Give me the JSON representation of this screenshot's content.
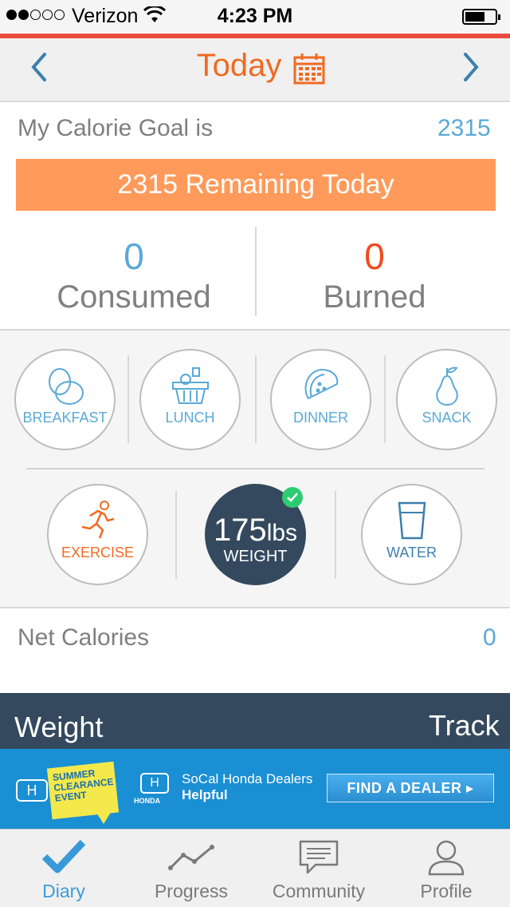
{
  "status_bar": {
    "carrier": "Verizon",
    "time": "4:23 PM",
    "signal_bars": 2,
    "signal_total": 5
  },
  "nav": {
    "title": "Today",
    "prev_icon": "chevron-left-icon",
    "next_icon": "chevron-right-icon",
    "calendar_icon": "calendar-icon"
  },
  "goal": {
    "label": "My Calorie Goal is",
    "value": "2315",
    "remaining_text": "2315 Remaining Today"
  },
  "stats": {
    "consumed_value": "0",
    "consumed_label": "Consumed",
    "burned_value": "0",
    "burned_label": "Burned"
  },
  "meals": [
    {
      "label": "BREAKFAST",
      "icon": "eggs-icon"
    },
    {
      "label": "LUNCH",
      "icon": "basket-icon"
    },
    {
      "label": "DINNER",
      "icon": "taco-icon"
    },
    {
      "label": "SNACK",
      "icon": "pear-icon"
    }
  ],
  "activities": {
    "exercise_label": "EXERCISE",
    "weight_value": "175",
    "weight_unit": "lbs",
    "weight_label": "WEIGHT",
    "water_label": "WATER"
  },
  "net": {
    "label": "Net Calories",
    "value": "0"
  },
  "weight_section": {
    "title": "Weight",
    "action": "Track"
  },
  "ad": {
    "promo_text": "SUMMER CLEARANCE EVENT",
    "brand": "HONDA",
    "dealer_line1": "SoCal Honda Dealers",
    "dealer_line2": "Helpful",
    "cta": "FIND A DEALER ▸"
  },
  "tabs": [
    {
      "label": "Diary",
      "icon": "checkmark-icon",
      "active": true
    },
    {
      "label": "Progress",
      "icon": "chart-line-icon",
      "active": false
    },
    {
      "label": "Community",
      "icon": "chat-bubble-icon",
      "active": false
    },
    {
      "label": "Profile",
      "icon": "person-icon",
      "active": false
    }
  ],
  "colors": {
    "accent_orange": "#f06a22",
    "remaining_bar": "#ff9a5a",
    "blue": "#5aa9d6",
    "burned_red": "#f04a1e",
    "dark_navy": "#34495e",
    "status_red": "#e84c3d",
    "ad_blue": "#1a8fd3"
  }
}
